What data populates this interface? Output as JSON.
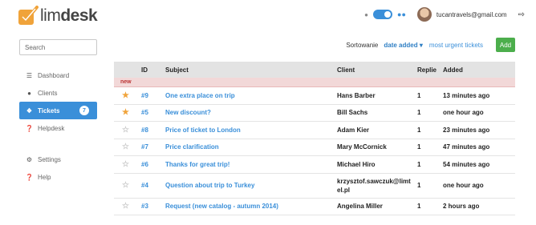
{
  "brand": {
    "name_plain": "lim",
    "name_bold": "desk",
    "accent": "#f0a33a"
  },
  "header": {
    "email": "tucantravels@gmail.com",
    "toggle_color": "#3a8fd9"
  },
  "search": {
    "placeholder": "Search"
  },
  "sidebar": {
    "items": [
      {
        "label": "Dashboard",
        "icon": "dashboard-icon"
      },
      {
        "label": "Clients",
        "icon": "user-icon"
      },
      {
        "label": "Tickets",
        "icon": "ticket-icon",
        "badge": "7"
      },
      {
        "label": "Helpdesk",
        "icon": "question-circle-icon"
      },
      {
        "label": "Settings",
        "icon": "gear-icon"
      },
      {
        "label": "Help",
        "icon": "question-circle-icon"
      }
    ]
  },
  "sort": {
    "label": "Sortowanie",
    "active": "date added",
    "other": "most urgent tickets",
    "add_label": "Add"
  },
  "table": {
    "columns": [
      "ID",
      "Subject",
      "Client",
      "Replie",
      "Added"
    ],
    "new_label": "new",
    "rows": [
      {
        "star": true,
        "id": "#9",
        "subject": "One extra place on trip",
        "client": "Hans Barber",
        "replies": "1",
        "added": "13 minutes ago"
      },
      {
        "star": true,
        "id": "#5",
        "subject": "New discount?",
        "client": "Bill Sachs",
        "replies": "1",
        "added": "one hour ago"
      },
      {
        "star": false,
        "id": "#8",
        "subject": "Price of ticket to London",
        "client": "Adam Kier",
        "replies": "1",
        "added": "23 minutes ago"
      },
      {
        "star": false,
        "id": "#7",
        "subject": "Price clarification",
        "client": "Mary McCornick",
        "replies": "1",
        "added": "47 minutes ago"
      },
      {
        "star": false,
        "id": "#6",
        "subject": "Thanks for great trip!",
        "client": "Michael Hiro",
        "replies": "1",
        "added": "54 minutes ago"
      },
      {
        "star": false,
        "id": "#4",
        "subject": "Question about trip to Turkey",
        "client": "krzysztof.sawczuk@limtel.pl",
        "replies": "1",
        "added": "one hour ago"
      },
      {
        "star": false,
        "id": "#3",
        "subject": "Request (new catalog - autumn 2014)",
        "client": "Angelina Miller",
        "replies": "1",
        "added": "2 hours ago"
      }
    ]
  }
}
